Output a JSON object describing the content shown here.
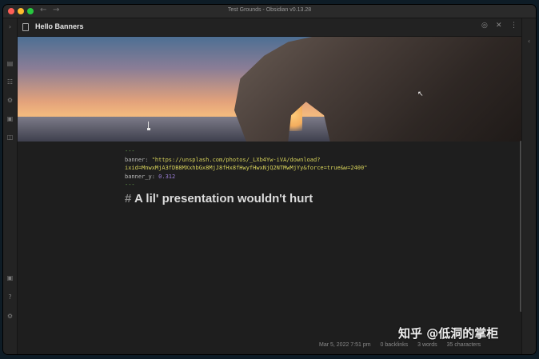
{
  "window": {
    "title": "Test Grounds - Obsidian v0.13.28"
  },
  "pane": {
    "title": "Hello Banners"
  },
  "frontmatter": {
    "open": "---",
    "banner_key": "banner: ",
    "banner_value_1": "\"https://unsplash.com/photos/_LXb4Yw-iVA/download?",
    "banner_value_2": "ixid=MnwxMjA3fDB8MXxhbGx8MjJ8fHx8fHwyfHwxNjQ2NTMwMjYy&force=true&w=2400\"",
    "banner_y_key": "banner_y: ",
    "banner_y_value": "0.312",
    "close": "---"
  },
  "heading": {
    "hash": "# ",
    "text": "A lil' presentation wouldn't hurt"
  },
  "statusbar": {
    "modified": "Mar 5, 2022 7:51 pm",
    "backlinks": "0 backlinks",
    "words": "3 words",
    "characters": "35 characters"
  },
  "watermark": "知乎 @低洞的掌柜",
  "icons": {
    "nav_back": "←",
    "nav_forward": "→",
    "ribbon": [
      "›",
      "▤",
      "☷",
      "⚙",
      "▣",
      "◫"
    ],
    "ribbon_bottom": [
      "▣",
      "?",
      "⚙"
    ],
    "reading_view": "◎",
    "close": "✕",
    "more": "⋮",
    "collapse_right": "‹"
  },
  "colors": {
    "accent_string": "#d7d25a",
    "accent_number": "#9b7fd8",
    "frontmatter_dash": "#6aa84f"
  }
}
